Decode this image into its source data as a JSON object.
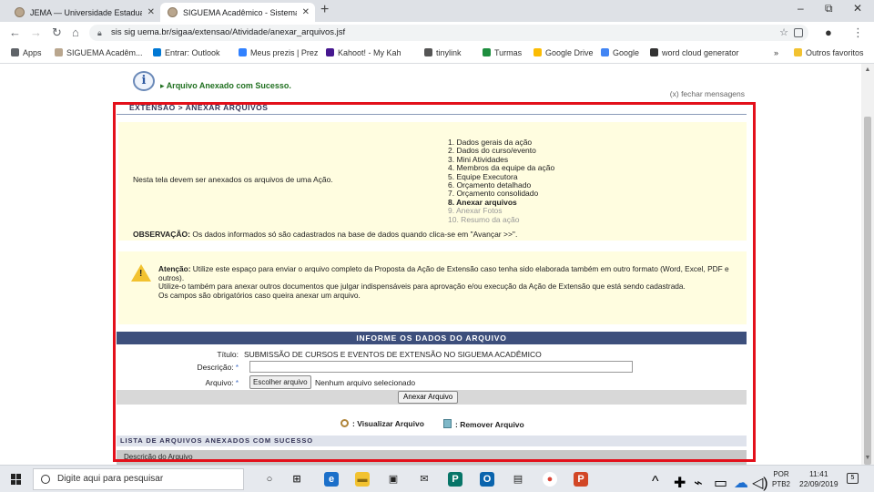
{
  "browser": {
    "tabs": [
      {
        "title": "JEMA — Universidade Estadual d",
        "active": false
      },
      {
        "title": "SIGUEMA Acadêmico - Sistema In",
        "active": true
      }
    ],
    "new_tab": "+",
    "window_buttons": [
      "–",
      "⧉",
      "✕"
    ],
    "url": "sis sig uema.br/sigaa/extensao/Atividade/anexar_arquivos.jsf",
    "bookmarks": [
      {
        "label": "Apps",
        "color": "#5f6368"
      },
      {
        "label": "SIGUEMA Acadêm...",
        "color": "#b9a68e"
      },
      {
        "label": "Entrar: Outlook",
        "color": "#0078d4"
      },
      {
        "label": "Meus prezis | Prez",
        "color": "#3181ff"
      },
      {
        "label": "Kahoot! - My Kah",
        "color": "#46178f"
      },
      {
        "label": "tinylink",
        "color": "#555555"
      },
      {
        "label": "Turmas",
        "color": "#1e8e3e"
      },
      {
        "label": "Google Drive",
        "color": "#fbbc04"
      },
      {
        "label": "Google",
        "color": "#4285f4"
      },
      {
        "label": "word cloud generator",
        "color": "#333333"
      }
    ],
    "bookmarks_more": "»",
    "other_bookmarks": "Outros favoritos"
  },
  "page": {
    "message": "Arquivo Anexado com Sucesso.",
    "close_messages": "(x) fechar mensagens",
    "breadcrumb": "EXTENSÃO > ANEXAR ARQUIVOS",
    "intro": "Nesta tela devem ser anexados os arquivos de uma Ação.",
    "steps": [
      {
        "label": "1. Dados gerais da ação",
        "state": "normal"
      },
      {
        "label": "2. Dados do curso/evento",
        "state": "normal"
      },
      {
        "label": "3. Mini Atividades",
        "state": "normal"
      },
      {
        "label": "4. Membros da equipe da ação",
        "state": "normal"
      },
      {
        "label": "5. Equipe Executora",
        "state": "normal"
      },
      {
        "label": "6. Orçamento detalhado",
        "state": "normal"
      },
      {
        "label": "7. Orçamento consolidado",
        "state": "normal"
      },
      {
        "label": "8. Anexar arquivos",
        "state": "current"
      },
      {
        "label": "9. Anexar Fotos",
        "state": "dim"
      },
      {
        "label": "10. Resumo da ação",
        "state": "dim"
      }
    ],
    "observation_label": "OBSERVAÇÃO:",
    "observation_text": " Os dados informados só são cadastrados na base de dados quando clica-se em \"Avançar >>\".",
    "warning_label": "Atenção:",
    "warning_line1": " Utilize este espaço para enviar o arquivo completo da Proposta da Ação de Extensão caso tenha sido elaborada também em outro formato (Word, Excel, PDF e outros).",
    "warning_line2": "Utilize-o também para anexar outros documentos que julgar indispensáveis para aprovação e/ou execução da Ação de Extensão que está sendo cadastrada.",
    "warning_line3": "Os campos são obrigatórios caso queira anexar um arquivo.",
    "form_title": "INFORME OS DADOS DO ARQUIVO",
    "title_label": "Título:",
    "title_value": "SUBMISSÃO DE CURSOS E EVENTOS DE EXTENSÃO NO SIGUEMA ACADÊMICO",
    "description_label": "Descrição:",
    "description_value": "",
    "file_label": "Arquivo:",
    "required_mark": "*",
    "choose_file": "Escolher arquivo",
    "no_file": "Nenhum arquivo selecionado",
    "submit": "Anexar Arquivo",
    "view_file": ": Visualizar Arquivo",
    "remove_file": ": Remover Arquivo",
    "list_title": "LISTA DE ARQUIVOS ANEXADOS COM SUCESSO",
    "list_column": "Descrição do Arquivo"
  },
  "taskbar": {
    "search_placeholder": "Digite aqui para pesquisar",
    "apps": [
      {
        "name": "task-view",
        "glyph": "○",
        "color": "#e6e9ee",
        "fg": "#222222"
      },
      {
        "name": "multitask",
        "glyph": "⊞",
        "color": "#e6e9ee",
        "fg": "#222222"
      },
      {
        "name": "edge",
        "glyph": "e",
        "color": "#1b6fc9",
        "fg": "#ffffff"
      },
      {
        "name": "file-explorer",
        "glyph": "▬",
        "color": "#f2c230",
        "fg": "#8a6a10"
      },
      {
        "name": "store",
        "glyph": "▣",
        "color": "#e6e9ee",
        "fg": "#222222"
      },
      {
        "name": "mail",
        "glyph": "✉",
        "color": "#e6e9ee",
        "fg": "#222222"
      },
      {
        "name": "publisher",
        "glyph": "P",
        "color": "#077568",
        "fg": "#ffffff"
      },
      {
        "name": "outlook",
        "glyph": "O",
        "color": "#0a64ad",
        "fg": "#ffffff"
      },
      {
        "name": "calculator",
        "glyph": "▤",
        "color": "#e6e9ee",
        "fg": "#222222"
      },
      {
        "name": "chrome",
        "glyph": "●",
        "color": "#ffffff",
        "fg": "#db4437"
      },
      {
        "name": "powerpoint",
        "glyph": "P",
        "color": "#d24726",
        "fg": "#ffffff"
      }
    ],
    "tray_icons": [
      "^",
      "✚",
      "⌁",
      "▭",
      "☁",
      "◁)"
    ],
    "lang_top": "POR",
    "lang_bottom": "PTB2",
    "time": "11:41",
    "date": "22/09/2019",
    "notifications": "5"
  }
}
